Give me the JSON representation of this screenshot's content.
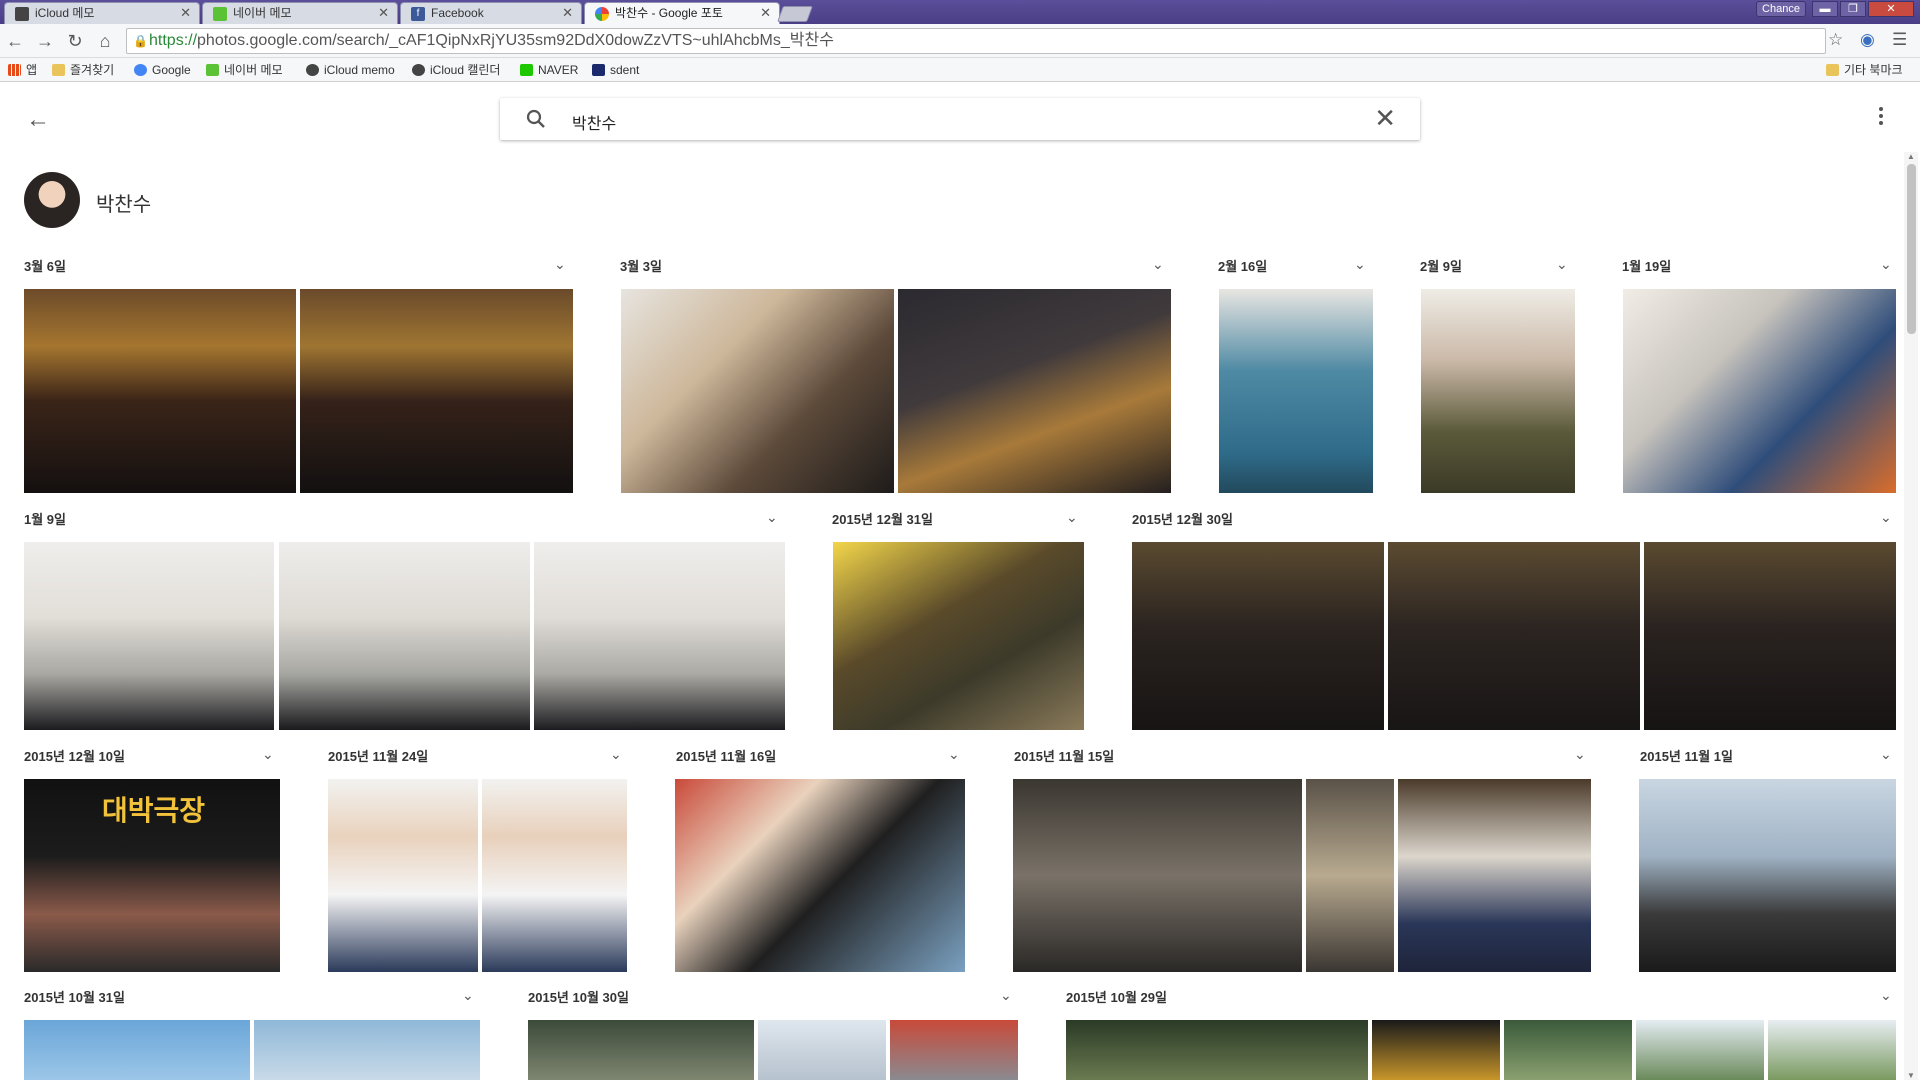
{
  "window": {
    "user_badge": "Chance",
    "minimize": "▬",
    "maximize": "❐",
    "close": "✕"
  },
  "tabs": [
    {
      "label": "iCloud 메모",
      "favicon": "apple-icon"
    },
    {
      "label": "네이버 메모",
      "favicon": "naver-memo-icon"
    },
    {
      "label": "Facebook",
      "favicon": "facebook-icon"
    },
    {
      "label": "박찬수 - Google 포토",
      "favicon": "google-photos-icon"
    }
  ],
  "address_bar": {
    "scheme": "https://",
    "url": "photos.google.com/search/_cAF1QipNxRjYU35sm92DdX0dowZzVTS~uhlAhcbMs_박찬수"
  },
  "bookmarks": {
    "apps": "앱",
    "items": [
      "즐겨찾기",
      "Google",
      "네이버 메모",
      "iCloud memo",
      "iCloud 캘린더",
      "NAVER",
      "sdent"
    ],
    "other": "기타 북마크"
  },
  "search": {
    "query": "박찬수"
  },
  "person": {
    "name": "박찬수"
  },
  "groups": [
    {
      "date": "3월 6일"
    },
    {
      "date": "3월 3일"
    },
    {
      "date": "2월 16일"
    },
    {
      "date": "2월 9일"
    },
    {
      "date": "1월 19일"
    },
    {
      "date": "1월 9일"
    },
    {
      "date": "2015년 12월 31일"
    },
    {
      "date": "2015년 12월 30일"
    },
    {
      "date": "2015년 12월 10일"
    },
    {
      "date": "2015년 11월 24일"
    },
    {
      "date": "2015년 11월 16일"
    },
    {
      "date": "2015년 11월 15일"
    },
    {
      "date": "2015년 11월 1일"
    },
    {
      "date": "2015년 10월 31일"
    },
    {
      "date": "2015년 10월 30일"
    },
    {
      "date": "2015년 10월 29일"
    }
  ],
  "theater_sign": "대박극장",
  "colors": {
    "tabstrip": "#4a3f86",
    "link_green": "#2a8a3a"
  }
}
